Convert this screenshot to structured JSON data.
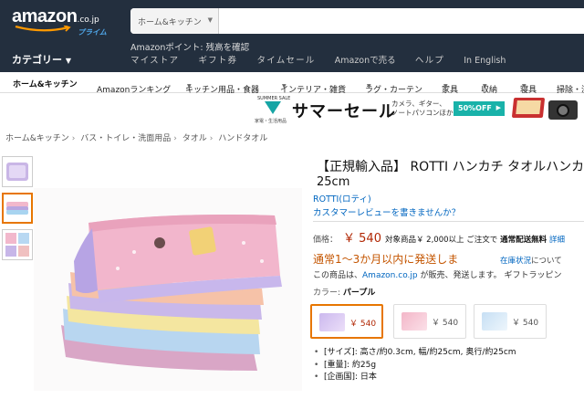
{
  "header": {
    "logo_word": "amazon",
    "logo_cojp": ".co.jp",
    "logo_prime": "プライム",
    "search_category": "ホーム&キッチン",
    "search_value": "",
    "points_line": "Amazonポイント: 残高を確認",
    "category_label": "カテゴリー",
    "nav_links": [
      "マイストア",
      "ギフト券",
      "タイムセール",
      "Amazonで売る",
      "ヘルプ",
      "In English"
    ]
  },
  "subnav": {
    "home": "ホーム&キッチン",
    "items": [
      "Amazonランキング",
      "キッチン用品・食器",
      "インテリア・雑貨",
      "ラグ・カーテン",
      "家具",
      "収納",
      "寝具",
      "掃除・洗"
    ]
  },
  "promo": {
    "badge_top": "SUMMER SALE",
    "badge_sub": "家電・生活用品",
    "title": "サマーセール",
    "desc_line1": "カメラ、ギター、",
    "desc_line2": "ノートパソコンほか",
    "off_label": "50%OFF"
  },
  "breadcrumb": [
    "ホーム&キッチン",
    "バス・トイレ・洗面用品",
    "タオル",
    "ハンドタオル"
  ],
  "product": {
    "title_line1": "【正規輸入品】 ROTTI ハンカチ タオルハンカ",
    "title_line2": "25cm",
    "brand": "ROTTI(ロティ)",
    "review_link": "カスタマーレビューを書きませんか？",
    "price_label": "価格：",
    "price": "￥ 540",
    "shipping_text": "対象商品￥ 2,000以上 ご注文で",
    "shipping_bold": "通常配送無料",
    "shipping_link": "詳細",
    "instock": "通常1～3か月以内に発送しま",
    "stock_note_link": "在庫状況",
    "stock_note_tail": "について",
    "soldby_pre": "この商品は、",
    "soldby_link": "Amazon.co.jp",
    "soldby_post": " が販売、発送します。 ギフトラッピン",
    "color_label": "カラー: ",
    "color_value": "パープル",
    "swatch_prices": [
      "￥ 540",
      "￥ 540",
      "￥ 540"
    ],
    "bullets": [
      "[サイズ]: 高さ/約0.3cm, 幅/約25cm, 奥行/約25cm",
      "[重量]: 約25g",
      "[企画国]: 日本"
    ]
  },
  "colors": {
    "header_bg": "#232f3e",
    "price_red": "#b12704",
    "link_blue": "#0066c0",
    "selected_orange": "#e77600",
    "promo_teal": "#19b2a9"
  }
}
